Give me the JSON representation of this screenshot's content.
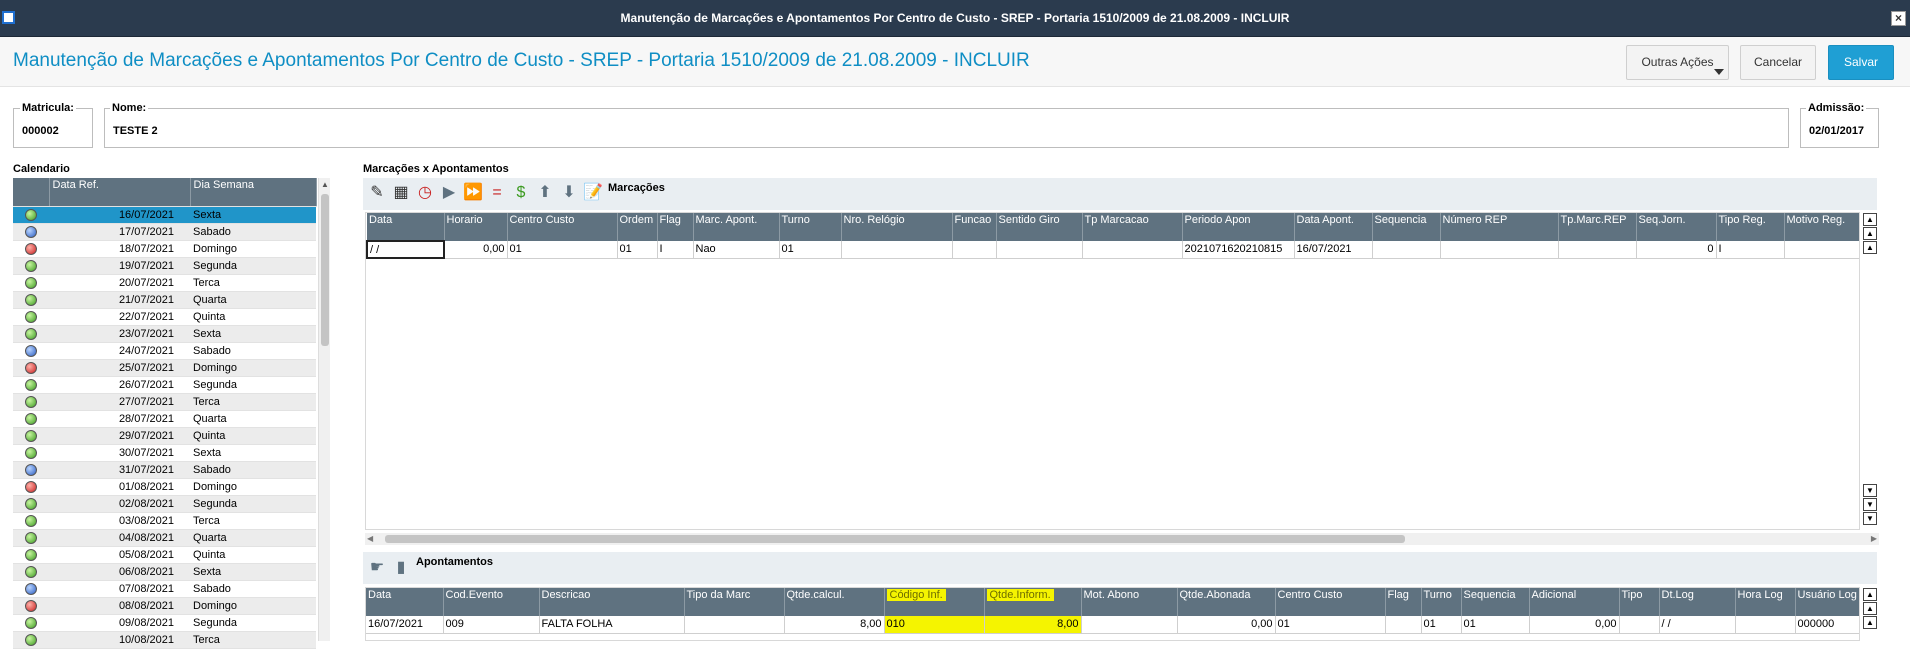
{
  "window": {
    "title": "Manutenção de Marcações e Apontamentos Por Centro de Custo - SREP - Portaria 1510/2009 de 21.08.2009 - INCLUIR"
  },
  "header": {
    "title": "Manutenção de Marcações e Apontamentos Por Centro de Custo - SREP - Portaria 1510/2009 de 21.08.2009 - INCLUIR",
    "other_actions_label": "Outras Ações",
    "cancel_label": "Cancelar",
    "save_label": "Salvar"
  },
  "fields": {
    "matricula": {
      "label": "Matricula:",
      "value": "000002"
    },
    "nome": {
      "label": "Nome:",
      "value": "TESTE 2"
    },
    "admissao": {
      "label": "Admissão:",
      "value": "02/01/2017"
    }
  },
  "calendar": {
    "title": "Calendario",
    "columns": [
      "Data Ref.",
      "Dia Semana"
    ],
    "rows": [
      {
        "status": "green",
        "date": "16/07/2021",
        "day": "Sexta"
      },
      {
        "status": "blue",
        "date": "17/07/2021",
        "day": "Sabado"
      },
      {
        "status": "red",
        "date": "18/07/2021",
        "day": "Domingo"
      },
      {
        "status": "green",
        "date": "19/07/2021",
        "day": "Segunda"
      },
      {
        "status": "green",
        "date": "20/07/2021",
        "day": "Terca"
      },
      {
        "status": "green",
        "date": "21/07/2021",
        "day": "Quarta"
      },
      {
        "status": "green",
        "date": "22/07/2021",
        "day": "Quinta"
      },
      {
        "status": "green",
        "date": "23/07/2021",
        "day": "Sexta"
      },
      {
        "status": "blue",
        "date": "24/07/2021",
        "day": "Sabado"
      },
      {
        "status": "red",
        "date": "25/07/2021",
        "day": "Domingo"
      },
      {
        "status": "green",
        "date": "26/07/2021",
        "day": "Segunda"
      },
      {
        "status": "green",
        "date": "27/07/2021",
        "day": "Terca"
      },
      {
        "status": "green",
        "date": "28/07/2021",
        "day": "Quarta"
      },
      {
        "status": "green",
        "date": "29/07/2021",
        "day": "Quinta"
      },
      {
        "status": "green",
        "date": "30/07/2021",
        "day": "Sexta"
      },
      {
        "status": "blue",
        "date": "31/07/2021",
        "day": "Sabado"
      },
      {
        "status": "red",
        "date": "01/08/2021",
        "day": "Domingo"
      },
      {
        "status": "green",
        "date": "02/08/2021",
        "day": "Segunda"
      },
      {
        "status": "green",
        "date": "03/08/2021",
        "day": "Terca"
      },
      {
        "status": "green",
        "date": "04/08/2021",
        "day": "Quarta"
      },
      {
        "status": "green",
        "date": "05/08/2021",
        "day": "Quinta"
      },
      {
        "status": "green",
        "date": "06/08/2021",
        "day": "Sexta"
      },
      {
        "status": "blue",
        "date": "07/08/2021",
        "day": "Sabado"
      },
      {
        "status": "red",
        "date": "08/08/2021",
        "day": "Domingo"
      },
      {
        "status": "green",
        "date": "09/08/2021",
        "day": "Segunda"
      },
      {
        "status": "green",
        "date": "10/08/2021",
        "day": "Terca"
      }
    ]
  },
  "marcacoes": {
    "section_title": "Marcações x Apontamentos",
    "subtitle": "Marcações",
    "columns": [
      "Data",
      "Horario",
      "Centro Custo",
      "Ordem",
      "Flag",
      "Marc. Apont.",
      "Turno",
      "Nro. Relógio",
      "Funcao",
      "Sentido Giro",
      "Tp Marcacao",
      "Periodo Apon",
      "Data Apont.",
      "Sequencia",
      "Número REP",
      "Tp.Marc.REP",
      "Seq.Jorn.",
      "Tipo Reg.",
      "Motivo Reg."
    ],
    "rows": [
      [
        " /  /",
        "0,00",
        "01",
        "01",
        "I",
        "Nao",
        "01",
        "",
        "",
        "",
        "",
        "2021071620210815",
        "16/07/2021",
        "",
        "",
        "",
        "0",
        "I",
        ""
      ]
    ]
  },
  "apontamentos": {
    "subtitle": "Apontamentos",
    "columns": [
      "Data",
      "Cod.Evento",
      "Descricao",
      "Tipo da Marc",
      "Qtde.calcul.",
      "Código Inf.",
      "Qtde.Inform.",
      "Mot. Abono",
      "Qtde.Abonada",
      "Centro Custo",
      "Flag",
      "Turno",
      "Sequencia",
      "Adicional",
      "Tipo",
      "Dt.Log",
      "Hora Log",
      "Usuário Log"
    ],
    "rows": [
      [
        "16/07/2021",
        "009",
        "FALTA FOLHA",
        "",
        "8,00",
        "010",
        "8,00",
        "",
        "0,00",
        "01",
        "",
        "01",
        "01",
        "0,00",
        "",
        " /  /",
        "",
        "000000"
      ]
    ]
  },
  "colors": {
    "accent": "#1f9fd4",
    "grid_header": "#5f7280",
    "highlight": "#f5f400",
    "title_bar": "#2b3b4e"
  }
}
